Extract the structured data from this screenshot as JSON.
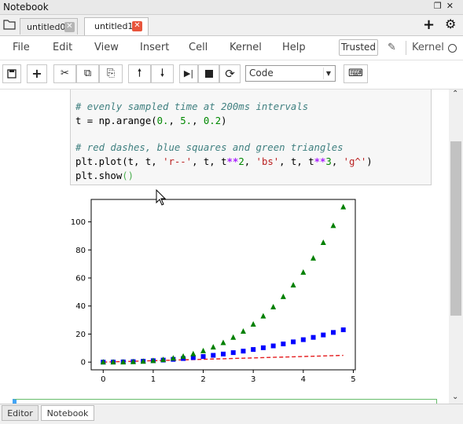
{
  "window": {
    "title": "Notebook",
    "icons": [
      "restore-icon",
      "close-icon"
    ]
  },
  "tabs": [
    {
      "label": "untitled0",
      "active": false,
      "close_color": "#b5b5b5"
    },
    {
      "label": "untitled1",
      "active": true,
      "close_color": "#e8553c"
    }
  ],
  "tabstrip_actions": [
    "plus-icon",
    "gear-icon"
  ],
  "menu": [
    "File",
    "Edit",
    "View",
    "Insert",
    "Cell",
    "Kernel",
    "Help"
  ],
  "status": {
    "trusted": "Trusted",
    "kernel_label": "Kernel"
  },
  "toolbar": {
    "buttons": [
      "save-icon",
      "add-cell-icon",
      "cut-icon",
      "copy-icon",
      "paste-icon",
      "move-up-icon",
      "move-down-icon",
      "run-icon",
      "stop-icon",
      "restart-icon",
      "keyboard-icon"
    ],
    "cell_type": "Code"
  },
  "code_lines": {
    "comment1": "# evenly sampled time at 200ms intervals",
    "line1": "t = np.arange(0., 5., 0.2)",
    "comment2": "# red dashes, blue squares and green triangles",
    "line2": "plt.plot(t, t, 'r--', t, t**2, 'bs', t, t**3, 'g^')",
    "line3": "plt.show()"
  },
  "chart_data": {
    "type": "line",
    "x": [
      0.0,
      0.2,
      0.4,
      0.6,
      0.8,
      1.0,
      1.2,
      1.4,
      1.6,
      1.8,
      2.0,
      2.2,
      2.4,
      2.6,
      2.8,
      3.0,
      3.2,
      3.4,
      3.6,
      3.8,
      4.0,
      4.2,
      4.4,
      4.6,
      4.8
    ],
    "series": [
      {
        "style": "r--",
        "color": "#e41a1c",
        "marker": "line-dashed",
        "values": [
          0.0,
          0.2,
          0.4,
          0.6,
          0.8,
          1.0,
          1.2,
          1.4,
          1.6,
          1.8,
          2.0,
          2.2,
          2.4,
          2.6,
          2.8,
          3.0,
          3.2,
          3.4,
          3.6,
          3.8,
          4.0,
          4.2,
          4.4,
          4.6,
          4.8
        ]
      },
      {
        "style": "bs",
        "color": "#0000ff",
        "marker": "square",
        "values": [
          0.0,
          0.04,
          0.16,
          0.36,
          0.64,
          1.0,
          1.44,
          1.96,
          2.56,
          3.24,
          4.0,
          4.84,
          5.76,
          6.76,
          7.84,
          9.0,
          10.24,
          11.56,
          12.96,
          14.44,
          16.0,
          17.64,
          19.36,
          21.16,
          23.04
        ]
      },
      {
        "style": "g^",
        "color": "#008000",
        "marker": "triangle",
        "values": [
          0.0,
          0.008,
          0.064,
          0.216,
          0.512,
          1.0,
          1.728,
          2.744,
          4.096,
          5.832,
          8.0,
          10.648,
          13.824,
          17.576,
          21.952,
          27.0,
          32.768,
          39.304,
          46.656,
          54.872,
          64.0,
          74.088,
          85.184,
          97.336,
          110.592
        ]
      }
    ],
    "xlim": [
      -0.24,
      5.04
    ],
    "ylim": [
      -5.5,
      116
    ],
    "xticks": [
      "0",
      "1",
      "2",
      "3",
      "4",
      "5"
    ],
    "xtick_values": [
      0,
      1,
      2,
      3,
      4,
      5
    ],
    "yticks": [
      "0",
      "20",
      "40",
      "60",
      "80",
      "100"
    ],
    "ytick_values": [
      0,
      20,
      40,
      60,
      80,
      100
    ],
    "grid": false,
    "title": "",
    "xlabel": "",
    "ylabel": ""
  },
  "bottom_tabs": [
    {
      "label": "Editor",
      "active": false
    },
    {
      "label": "Notebook",
      "active": true
    }
  ]
}
